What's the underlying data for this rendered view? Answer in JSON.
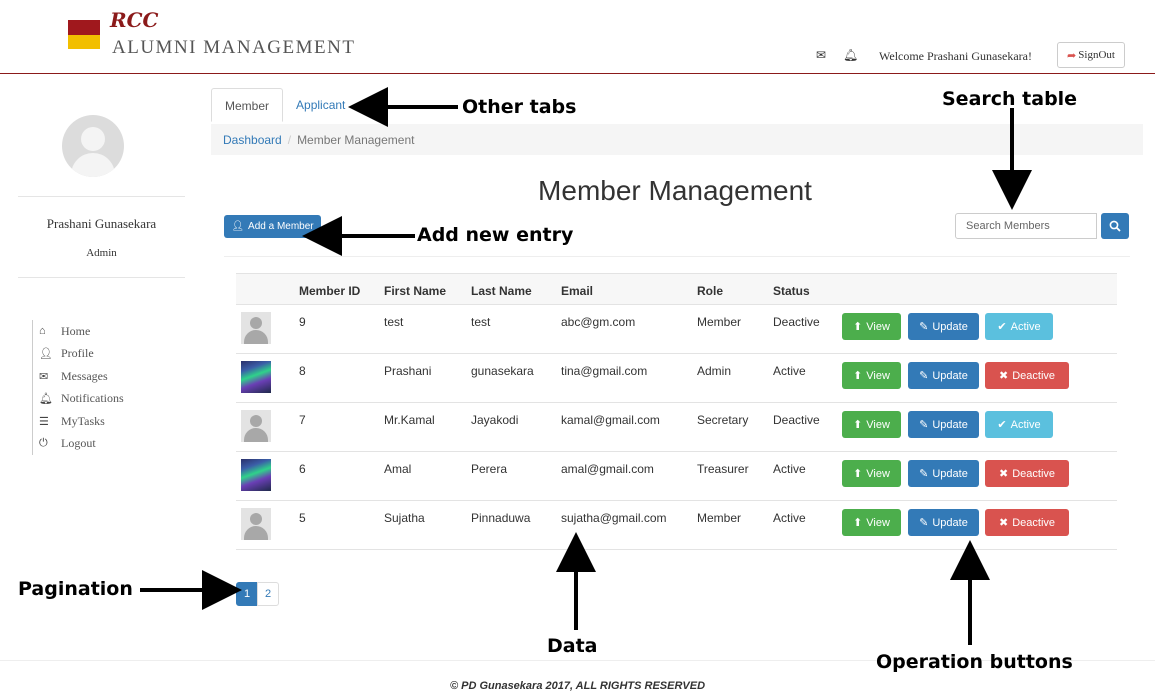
{
  "header": {
    "logo_top": "RCC",
    "logo_bottom": "ALUMNI MANAGEMENT",
    "mail_icon": "envelope-icon",
    "bell_icon": "bell-icon",
    "welcome": "Welcome Prashani Gunasekara!",
    "signout_label": "SignOut"
  },
  "sidebar": {
    "name": "Prashani Gunasekara",
    "role": "Admin",
    "nav": [
      {
        "icon": "home-icon",
        "label": "Home"
      },
      {
        "icon": "user-icon",
        "label": "Profile"
      },
      {
        "icon": "envelope-icon",
        "label": "Messages"
      },
      {
        "icon": "bell-icon",
        "label": "Notifications"
      },
      {
        "icon": "list-icon",
        "label": "MyTasks"
      },
      {
        "icon": "power-icon",
        "label": "Logout"
      }
    ]
  },
  "tabs": [
    {
      "label": "Member",
      "active": true
    },
    {
      "label": "Applicant",
      "active": false
    }
  ],
  "breadcrumb": {
    "link": "Dashboard",
    "separator": "/",
    "current": "Member Management"
  },
  "page_title": "Member Management",
  "search": {
    "placeholder": "Search Members"
  },
  "add_button_label": "Add a Member",
  "table": {
    "columns": [
      "Member ID",
      "First Name",
      "Last Name",
      "Email",
      "Role",
      "Status"
    ],
    "rows": [
      {
        "id": "9",
        "first": "test",
        "last": "test",
        "email": "abc@gm.com",
        "role": "Member",
        "status": "Deactive",
        "toggle": "Active",
        "avatar": "default"
      },
      {
        "id": "8",
        "first": "Prashani",
        "last": "gunasekara",
        "email": "tina@gmail.com",
        "role": "Admin",
        "status": "Active",
        "toggle": "Deactive",
        "avatar": "photo"
      },
      {
        "id": "7",
        "first": "Mr.Kamal",
        "last": "Jayakodi",
        "email": "kamal@gmail.com",
        "role": "Secretary",
        "status": "Deactive",
        "toggle": "Active",
        "avatar": "default"
      },
      {
        "id": "6",
        "first": "Amal",
        "last": "Perera",
        "email": "amal@gmail.com",
        "role": "Treasurer",
        "status": "Active",
        "toggle": "Deactive",
        "avatar": "photo"
      },
      {
        "id": "5",
        "first": "Sujatha",
        "last": "Pinnaduwa",
        "email": "sujatha@gmail.com",
        "role": "Member",
        "status": "Active",
        "toggle": "Deactive",
        "avatar": "default"
      }
    ],
    "view_label": "View",
    "update_label": "Update"
  },
  "pagination": [
    "1",
    "2"
  ],
  "footer": "© PD Gunasekara 2017, ALL RIGHTS RESERVED",
  "annotations": {
    "tabs": "Other tabs",
    "search": "Search table",
    "add": "Add new entry",
    "pagination": "Pagination",
    "data": "Data",
    "ops": "Operation buttons"
  },
  "colors": {
    "primary": "#337ab7",
    "success": "#4cae4c",
    "info": "#5bc0de",
    "danger": "#d9534f",
    "brand_red": "#a0181d",
    "brand_gold": "#f2bf00"
  }
}
